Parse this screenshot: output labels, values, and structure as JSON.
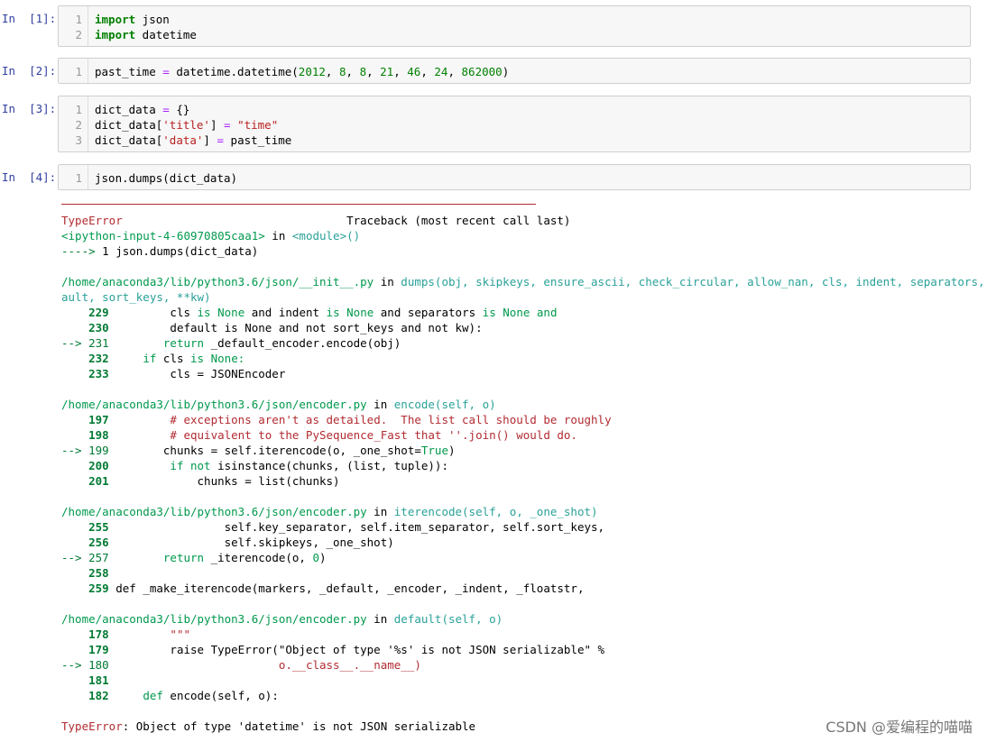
{
  "cells": [
    {
      "prompt": "In  [1]:",
      "lines": [
        {
          "n": "1",
          "tokens": [
            {
              "t": "import",
              "c": "kw"
            },
            {
              "t": " json",
              "c": ""
            }
          ]
        },
        {
          "n": "2",
          "tokens": [
            {
              "t": "import",
              "c": "kw"
            },
            {
              "t": " datetime",
              "c": ""
            }
          ]
        }
      ]
    },
    {
      "prompt": "In  [2]:",
      "lines": [
        {
          "n": "1",
          "tokens": [
            {
              "t": "past_time ",
              "c": ""
            },
            {
              "t": "=",
              "c": "op"
            },
            {
              "t": " datetime.datetime(",
              "c": ""
            },
            {
              "t": "2012",
              "c": "num"
            },
            {
              "t": ", ",
              "c": ""
            },
            {
              "t": "8",
              "c": "num"
            },
            {
              "t": ", ",
              "c": ""
            },
            {
              "t": "8",
              "c": "num"
            },
            {
              "t": ", ",
              "c": ""
            },
            {
              "t": "21",
              "c": "num"
            },
            {
              "t": ", ",
              "c": ""
            },
            {
              "t": "46",
              "c": "num"
            },
            {
              "t": ", ",
              "c": ""
            },
            {
              "t": "24",
              "c": "num"
            },
            {
              "t": ", ",
              "c": ""
            },
            {
              "t": "862000",
              "c": "num"
            },
            {
              "t": ")",
              "c": ""
            }
          ]
        }
      ]
    },
    {
      "prompt": "In  [3]:",
      "lines": [
        {
          "n": "1",
          "tokens": [
            {
              "t": "dict_data ",
              "c": ""
            },
            {
              "t": "=",
              "c": "op"
            },
            {
              "t": " {}",
              "c": ""
            }
          ]
        },
        {
          "n": "2",
          "tokens": [
            {
              "t": "dict_data[",
              "c": ""
            },
            {
              "t": "'title'",
              "c": "str"
            },
            {
              "t": "] ",
              "c": ""
            },
            {
              "t": "=",
              "c": "op"
            },
            {
              "t": " ",
              "c": ""
            },
            {
              "t": "\"time\"",
              "c": "str"
            }
          ]
        },
        {
          "n": "3",
          "tokens": [
            {
              "t": "dict_data[",
              "c": ""
            },
            {
              "t": "'data'",
              "c": "str"
            },
            {
              "t": "] ",
              "c": ""
            },
            {
              "t": "=",
              "c": "op"
            },
            {
              "t": " past_time",
              "c": ""
            }
          ]
        }
      ]
    },
    {
      "prompt": "In  [4]:",
      "lines": [
        {
          "n": "1",
          "tokens": [
            {
              "t": "json.dumps(dict_data)",
              "c": ""
            }
          ]
        }
      ]
    }
  ],
  "traceback": [
    [
      {
        "t": "TypeError",
        "c": "ered"
      },
      {
        "t": "                                 Traceback (most recent call last)",
        "c": ""
      }
    ],
    [
      {
        "t": "<ipython-input-4-60970805caa1>",
        "c": "green"
      },
      {
        "t": " in ",
        "c": ""
      },
      {
        "t": "<module>()",
        "c": "cyan"
      }
    ],
    [
      {
        "t": "---->",
        "c": "arrow"
      },
      {
        "t": " 1 json.dumps(dict_data)",
        "c": ""
      }
    ],
    [],
    [
      {
        "t": "/home/anaconda3/lib/python3.6/json/__init__.py",
        "c": "green"
      },
      {
        "t": " in ",
        "c": ""
      },
      {
        "t": "dumps(obj, skipkeys, ensure_ascii, check_circular, allow_nan, cls, indent, separators, def",
        "c": "cyan"
      }
    ],
    [
      {
        "t": "ault, sort_keys, **kw)",
        "c": "cyan"
      }
    ],
    [
      {
        "t": "    229",
        "c": "lnum"
      },
      {
        "t": "         cls ",
        "c": ""
      },
      {
        "t": "is",
        "c": "green"
      },
      {
        "t": " ",
        "c": ""
      },
      {
        "t": "None",
        "c": "green"
      },
      {
        "t": " and indent ",
        "c": ""
      },
      {
        "t": "is",
        "c": "green"
      },
      {
        "t": " ",
        "c": ""
      },
      {
        "t": "None",
        "c": "green"
      },
      {
        "t": " and separators ",
        "c": ""
      },
      {
        "t": "is",
        "c": "green"
      },
      {
        "t": " ",
        "c": ""
      },
      {
        "t": "None",
        "c": "green"
      },
      {
        "t": " and",
        "c": "green"
      }
    ],
    [
      {
        "t": "    230",
        "c": "lnum"
      },
      {
        "t": "         default is None and not sort_keys and not kw):",
        "c": ""
      }
    ],
    [
      {
        "t": "--> 231",
        "c": "arrow"
      },
      {
        "t": "        ",
        "c": ""
      },
      {
        "t": "return",
        "c": "green"
      },
      {
        "t": " _default_encoder.encode(obj)",
        "c": ""
      }
    ],
    [
      {
        "t": "    232",
        "c": "lnum"
      },
      {
        "t": "     ",
        "c": ""
      },
      {
        "t": "if",
        "c": "green"
      },
      {
        "t": " cls ",
        "c": ""
      },
      {
        "t": "is",
        "c": "green"
      },
      {
        "t": " ",
        "c": ""
      },
      {
        "t": "None:",
        "c": "green"
      }
    ],
    [
      {
        "t": "    233",
        "c": "lnum"
      },
      {
        "t": "         cls = JSONEncoder",
        "c": ""
      }
    ],
    [],
    [
      {
        "t": "/home/anaconda3/lib/python3.6/json/encoder.py",
        "c": "green"
      },
      {
        "t": " in ",
        "c": ""
      },
      {
        "t": "encode(self, o)",
        "c": "cyan"
      }
    ],
    [
      {
        "t": "    197",
        "c": "lnum"
      },
      {
        "t": "         ",
        "c": ""
      },
      {
        "t": "# exceptions aren't as detailed.  The list call should be roughly",
        "c": "ered"
      }
    ],
    [
      {
        "t": "    198",
        "c": "lnum"
      },
      {
        "t": "         ",
        "c": ""
      },
      {
        "t": "# equivalent to the PySequence_Fast that ''.join() would do.",
        "c": "ered"
      }
    ],
    [
      {
        "t": "--> 199",
        "c": "arrow"
      },
      {
        "t": "        chunks = self.iterencode(o, _one_shot=",
        "c": ""
      },
      {
        "t": "True",
        "c": "green"
      },
      {
        "t": ")",
        "c": ""
      }
    ],
    [
      {
        "t": "    200",
        "c": "lnum"
      },
      {
        "t": "         ",
        "c": ""
      },
      {
        "t": "if not",
        "c": "green"
      },
      {
        "t": " isinstance(chunks, (list, tuple)):",
        "c": ""
      }
    ],
    [
      {
        "t": "    201",
        "c": "lnum"
      },
      {
        "t": "             chunks = list(chunks)",
        "c": ""
      }
    ],
    [],
    [
      {
        "t": "/home/anaconda3/lib/python3.6/json/encoder.py",
        "c": "green"
      },
      {
        "t": " in ",
        "c": ""
      },
      {
        "t": "iterencode(self, o, _one_shot)",
        "c": "cyan"
      }
    ],
    [
      {
        "t": "    255",
        "c": "lnum"
      },
      {
        "t": "                 self.key_separator, self.item_separator, self.sort_keys,",
        "c": ""
      }
    ],
    [
      {
        "t": "    256",
        "c": "lnum"
      },
      {
        "t": "                 self.skipkeys, _one_shot)",
        "c": ""
      }
    ],
    [
      {
        "t": "--> 257",
        "c": "arrow"
      },
      {
        "t": "        ",
        "c": ""
      },
      {
        "t": "return",
        "c": "green"
      },
      {
        "t": " _iterencode(o, ",
        "c": ""
      },
      {
        "t": "0",
        "c": "green"
      },
      {
        "t": ")",
        "c": ""
      }
    ],
    [
      {
        "t": "    258",
        "c": "lnum"
      }
    ],
    [
      {
        "t": "    259",
        "c": "lnum"
      },
      {
        "t": " def _make_iterencode(markers, _default, _encoder, _indent, _floatstr,",
        "c": ""
      }
    ],
    [],
    [
      {
        "t": "/home/anaconda3/lib/python3.6/json/encoder.py",
        "c": "green"
      },
      {
        "t": " in ",
        "c": ""
      },
      {
        "t": "default(self, o)",
        "c": "cyan"
      }
    ],
    [
      {
        "t": "    178",
        "c": "lnum"
      },
      {
        "t": "         \"\"\"",
        "c": "ered"
      }
    ],
    [
      {
        "t": "    179",
        "c": "lnum"
      },
      {
        "t": "         raise TypeError(\"Object of type '%s' is not JSON serializable\" %",
        "c": ""
      }
    ],
    [
      {
        "t": "--> 180",
        "c": "arrow"
      },
      {
        "t": "                         ",
        "c": ""
      },
      {
        "t": "o.__class__.__name__)",
        "c": "ered"
      }
    ],
    [
      {
        "t": "    181",
        "c": "lnum"
      }
    ],
    [
      {
        "t": "    182",
        "c": "lnum"
      },
      {
        "t": "     ",
        "c": ""
      },
      {
        "t": "def",
        "c": "green"
      },
      {
        "t": " encode(self, o):",
        "c": ""
      }
    ],
    [],
    [
      {
        "t": "TypeError",
        "c": "ered"
      },
      {
        "t": ": Object of type 'datetime' is not JSON serializable",
        "c": ""
      }
    ]
  ],
  "watermark": "CSDN @爱编程的喵喵"
}
